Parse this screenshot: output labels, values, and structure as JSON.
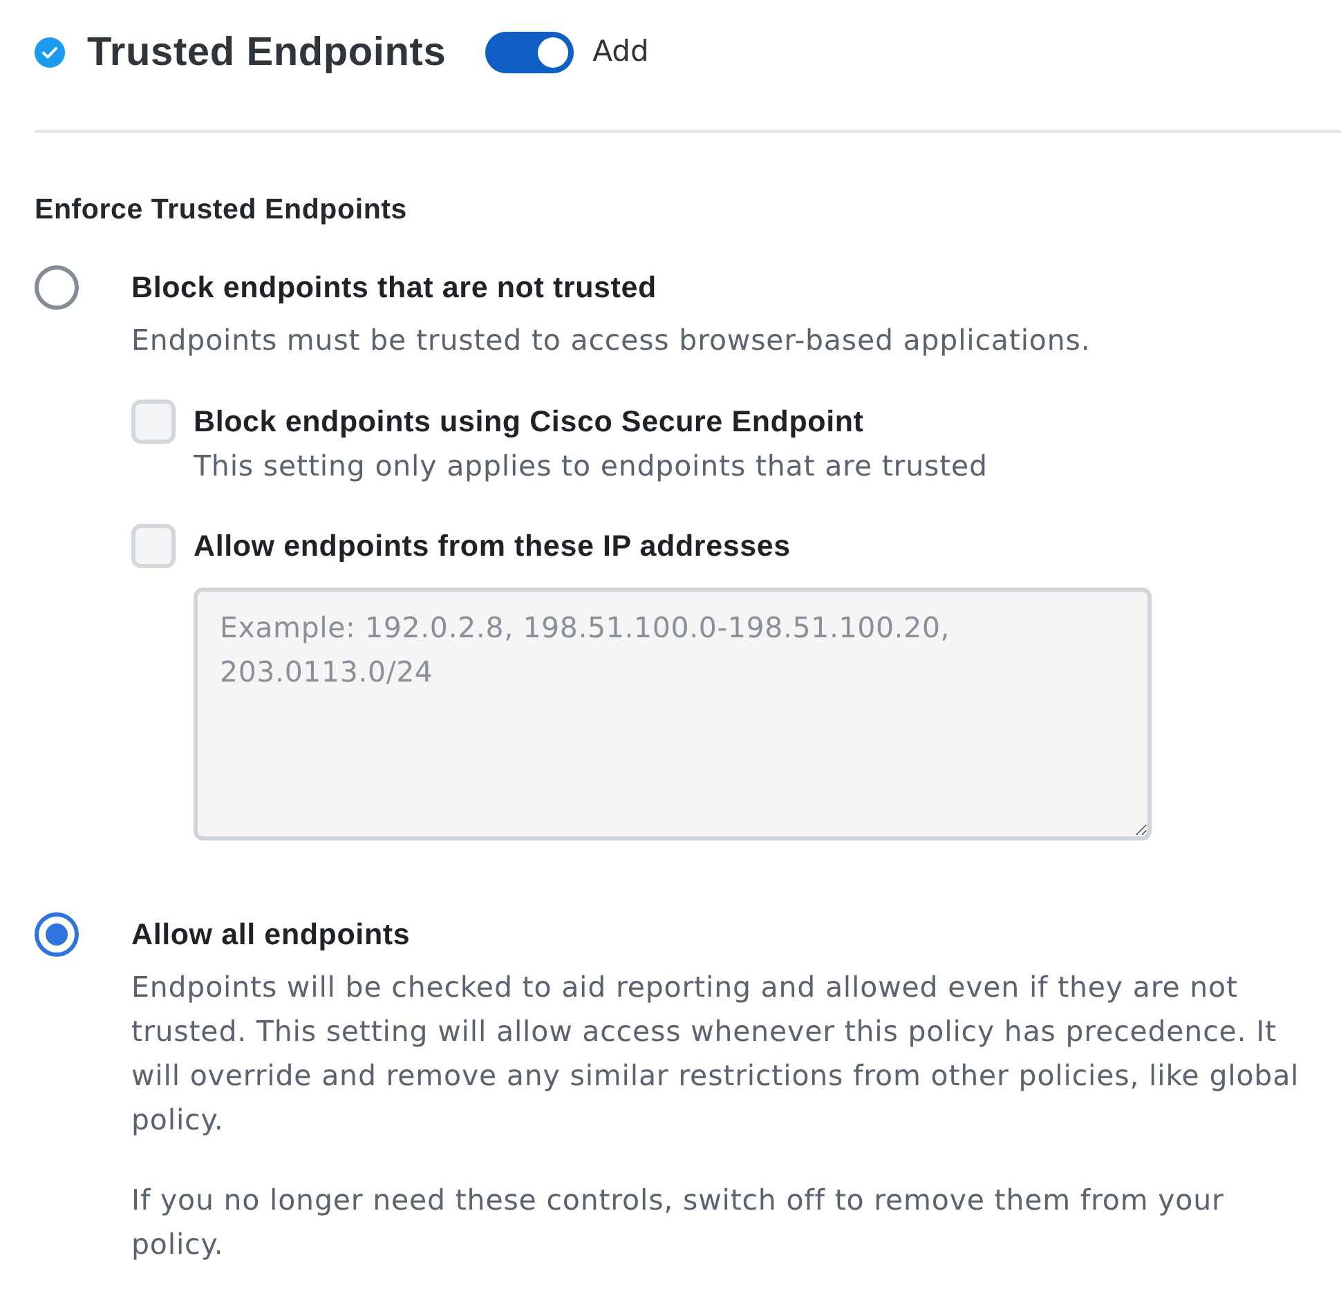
{
  "header": {
    "title": "Trusted Endpoints",
    "toggle": {
      "on": true,
      "label": "Add"
    }
  },
  "section": {
    "title": "Enforce Trusted Endpoints",
    "options": [
      {
        "label": "Block endpoints that are not trusted",
        "description": "Endpoints must be trusted to access browser-based applications.",
        "selected": false,
        "suboptions": [
          {
            "label": "Block endpoints using Cisco Secure Endpoint",
            "description": "This setting only applies to endpoints that are trusted",
            "checked": false
          },
          {
            "label": "Allow endpoints from these IP addresses",
            "checked": false,
            "field": {
              "placeholder": "Example: 192.0.2.8, 198.51.100.0-198.51.100.20, 203.0113.0/24"
            }
          }
        ]
      },
      {
        "label": "Allow all endpoints",
        "description": "Endpoints will be checked to aid reporting and allowed even if they are not trusted. This setting will allow access whenever this policy has precedence. It will override and remove any similar restrictions from other policies, like global policy.",
        "selected": true
      }
    ]
  },
  "note": "If you no longer need these controls, switch off to remove them from your policy."
}
